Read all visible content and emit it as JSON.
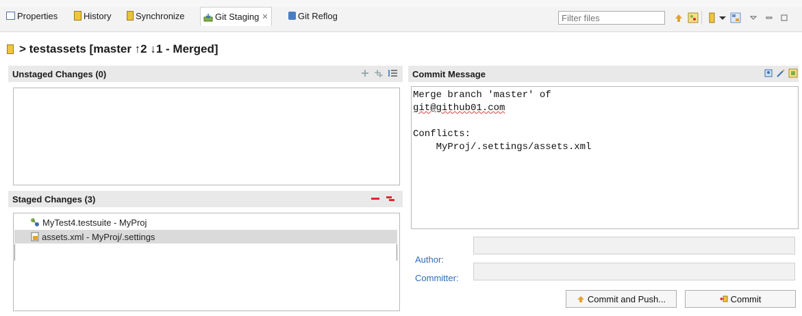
{
  "tabs": [
    {
      "label": "Properties",
      "icon": "properties-icon"
    },
    {
      "label": "History",
      "icon": "history-icon"
    },
    {
      "label": "Synchronize",
      "icon": "synchronize-icon"
    },
    {
      "label": "Git Staging",
      "icon": "git-staging-icon",
      "active": true
    },
    {
      "label": "Git Reflog",
      "icon": "git-reflog-icon"
    }
  ],
  "filter": {
    "placeholder": "Filter files"
  },
  "repo_title": "> testassets [master ↑2 ↓1 - Merged]",
  "unstaged": {
    "header": "Unstaged Changes (0)",
    "items": []
  },
  "staged": {
    "header": "Staged Changes (3)",
    "items": [
      {
        "label": "MyTest4.testsuite - MyProj",
        "icon": "testsuite-icon"
      },
      {
        "label": "assets.xml - MyProj/.settings",
        "icon": "xml-conflict-icon",
        "selected": true
      }
    ]
  },
  "commit": {
    "header": "Commit Message",
    "line1": "Merge branch 'master' of",
    "line2": "git@github01.com",
    "line3": "Conflicts:",
    "line4": "    MyProj/.settings/assets.xml"
  },
  "author_label": "Author:",
  "committer_label": "Committer:",
  "buttons": {
    "commit_and_push": "Commit and Push...",
    "commit": "Commit"
  },
  "colors": {
    "accent": "#2f6bb3",
    "header_bg": "#e9e9e9",
    "remove_red": "#d9282f"
  }
}
